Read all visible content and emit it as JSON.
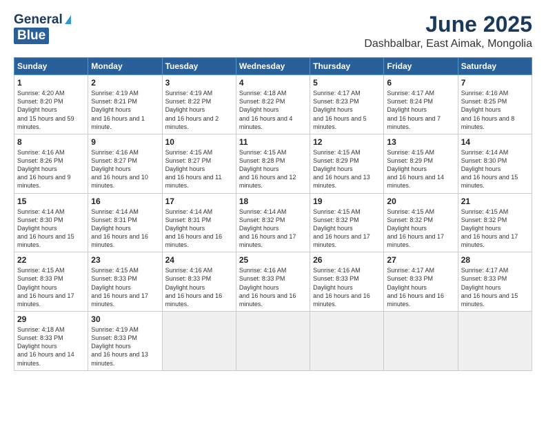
{
  "header": {
    "logo_general": "General",
    "logo_blue": "Blue",
    "month_title": "June 2025",
    "location": "Dashbalbar, East Aimak, Mongolia"
  },
  "weekdays": [
    "Sunday",
    "Monday",
    "Tuesday",
    "Wednesday",
    "Thursday",
    "Friday",
    "Saturday"
  ],
  "weeks": [
    [
      {
        "day": "1",
        "sunrise": "4:20 AM",
        "sunset": "8:20 PM",
        "daylight": "15 hours and 59 minutes."
      },
      {
        "day": "2",
        "sunrise": "4:19 AM",
        "sunset": "8:21 PM",
        "daylight": "16 hours and 1 minute."
      },
      {
        "day": "3",
        "sunrise": "4:19 AM",
        "sunset": "8:22 PM",
        "daylight": "16 hours and 2 minutes."
      },
      {
        "day": "4",
        "sunrise": "4:18 AM",
        "sunset": "8:22 PM",
        "daylight": "16 hours and 4 minutes."
      },
      {
        "day": "5",
        "sunrise": "4:17 AM",
        "sunset": "8:23 PM",
        "daylight": "16 hours and 5 minutes."
      },
      {
        "day": "6",
        "sunrise": "4:17 AM",
        "sunset": "8:24 PM",
        "daylight": "16 hours and 7 minutes."
      },
      {
        "day": "7",
        "sunrise": "4:16 AM",
        "sunset": "8:25 PM",
        "daylight": "16 hours and 8 minutes."
      }
    ],
    [
      {
        "day": "8",
        "sunrise": "4:16 AM",
        "sunset": "8:26 PM",
        "daylight": "16 hours and 9 minutes."
      },
      {
        "day": "9",
        "sunrise": "4:16 AM",
        "sunset": "8:27 PM",
        "daylight": "16 hours and 10 minutes."
      },
      {
        "day": "10",
        "sunrise": "4:15 AM",
        "sunset": "8:27 PM",
        "daylight": "16 hours and 11 minutes."
      },
      {
        "day": "11",
        "sunrise": "4:15 AM",
        "sunset": "8:28 PM",
        "daylight": "16 hours and 12 minutes."
      },
      {
        "day": "12",
        "sunrise": "4:15 AM",
        "sunset": "8:29 PM",
        "daylight": "16 hours and 13 minutes."
      },
      {
        "day": "13",
        "sunrise": "4:15 AM",
        "sunset": "8:29 PM",
        "daylight": "16 hours and 14 minutes."
      },
      {
        "day": "14",
        "sunrise": "4:14 AM",
        "sunset": "8:30 PM",
        "daylight": "16 hours and 15 minutes."
      }
    ],
    [
      {
        "day": "15",
        "sunrise": "4:14 AM",
        "sunset": "8:30 PM",
        "daylight": "16 hours and 15 minutes."
      },
      {
        "day": "16",
        "sunrise": "4:14 AM",
        "sunset": "8:31 PM",
        "daylight": "16 hours and 16 minutes."
      },
      {
        "day": "17",
        "sunrise": "4:14 AM",
        "sunset": "8:31 PM",
        "daylight": "16 hours and 16 minutes."
      },
      {
        "day": "18",
        "sunrise": "4:14 AM",
        "sunset": "8:32 PM",
        "daylight": "16 hours and 17 minutes."
      },
      {
        "day": "19",
        "sunrise": "4:15 AM",
        "sunset": "8:32 PM",
        "daylight": "16 hours and 17 minutes."
      },
      {
        "day": "20",
        "sunrise": "4:15 AM",
        "sunset": "8:32 PM",
        "daylight": "16 hours and 17 minutes."
      },
      {
        "day": "21",
        "sunrise": "4:15 AM",
        "sunset": "8:32 PM",
        "daylight": "16 hours and 17 minutes."
      }
    ],
    [
      {
        "day": "22",
        "sunrise": "4:15 AM",
        "sunset": "8:33 PM",
        "daylight": "16 hours and 17 minutes."
      },
      {
        "day": "23",
        "sunrise": "4:15 AM",
        "sunset": "8:33 PM",
        "daylight": "16 hours and 17 minutes."
      },
      {
        "day": "24",
        "sunrise": "4:16 AM",
        "sunset": "8:33 PM",
        "daylight": "16 hours and 16 minutes."
      },
      {
        "day": "25",
        "sunrise": "4:16 AM",
        "sunset": "8:33 PM",
        "daylight": "16 hours and 16 minutes."
      },
      {
        "day": "26",
        "sunrise": "4:16 AM",
        "sunset": "8:33 PM",
        "daylight": "16 hours and 16 minutes."
      },
      {
        "day": "27",
        "sunrise": "4:17 AM",
        "sunset": "8:33 PM",
        "daylight": "16 hours and 16 minutes."
      },
      {
        "day": "28",
        "sunrise": "4:17 AM",
        "sunset": "8:33 PM",
        "daylight": "16 hours and 15 minutes."
      }
    ],
    [
      {
        "day": "29",
        "sunrise": "4:18 AM",
        "sunset": "8:33 PM",
        "daylight": "16 hours and 14 minutes."
      },
      {
        "day": "30",
        "sunrise": "4:19 AM",
        "sunset": "8:33 PM",
        "daylight": "16 hours and 13 minutes."
      },
      null,
      null,
      null,
      null,
      null
    ]
  ]
}
